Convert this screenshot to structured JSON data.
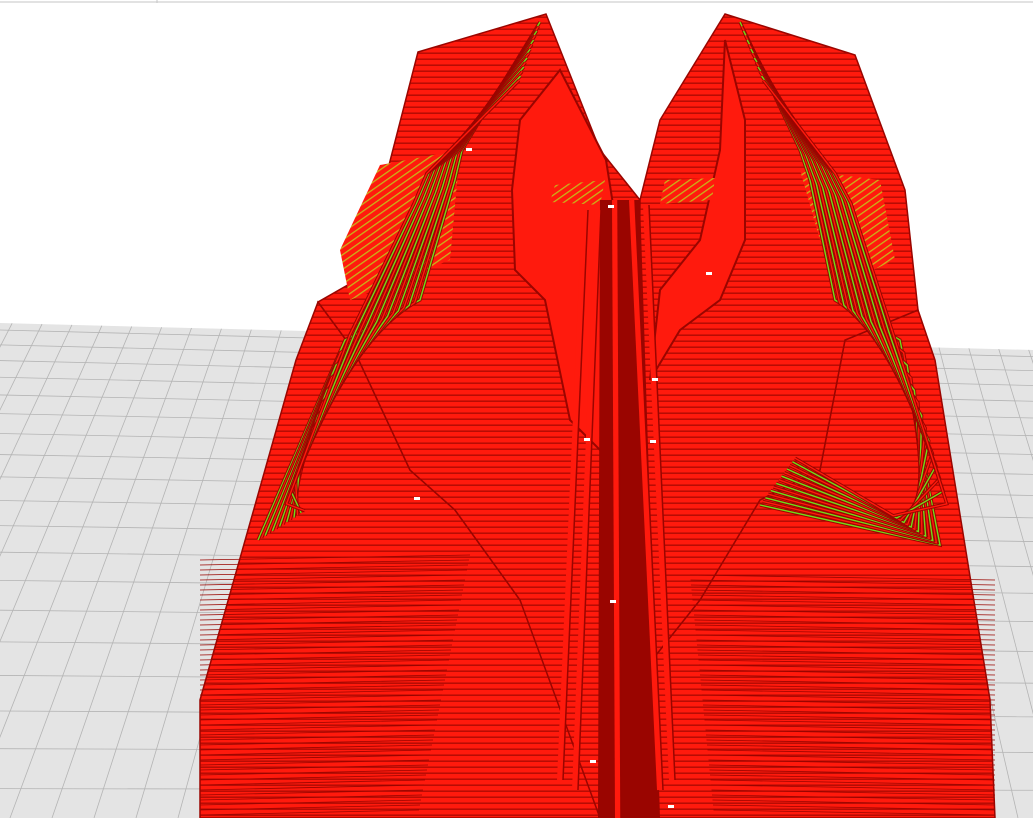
{
  "app": {
    "view": "layer-preview"
  },
  "scene": {
    "background_color": "#ffffff",
    "build_plate_color": "#e4e4e4",
    "grid_line_color": "#b4b4b4",
    "top_edge_line_color": "#c6c6c6",
    "wall_color": "#ff1a0d",
    "wall_dark_color": "#9a0500",
    "infill_color": "#6fdc1a",
    "skin_color": "#c9b419",
    "highlight_color": "#ffffff"
  }
}
